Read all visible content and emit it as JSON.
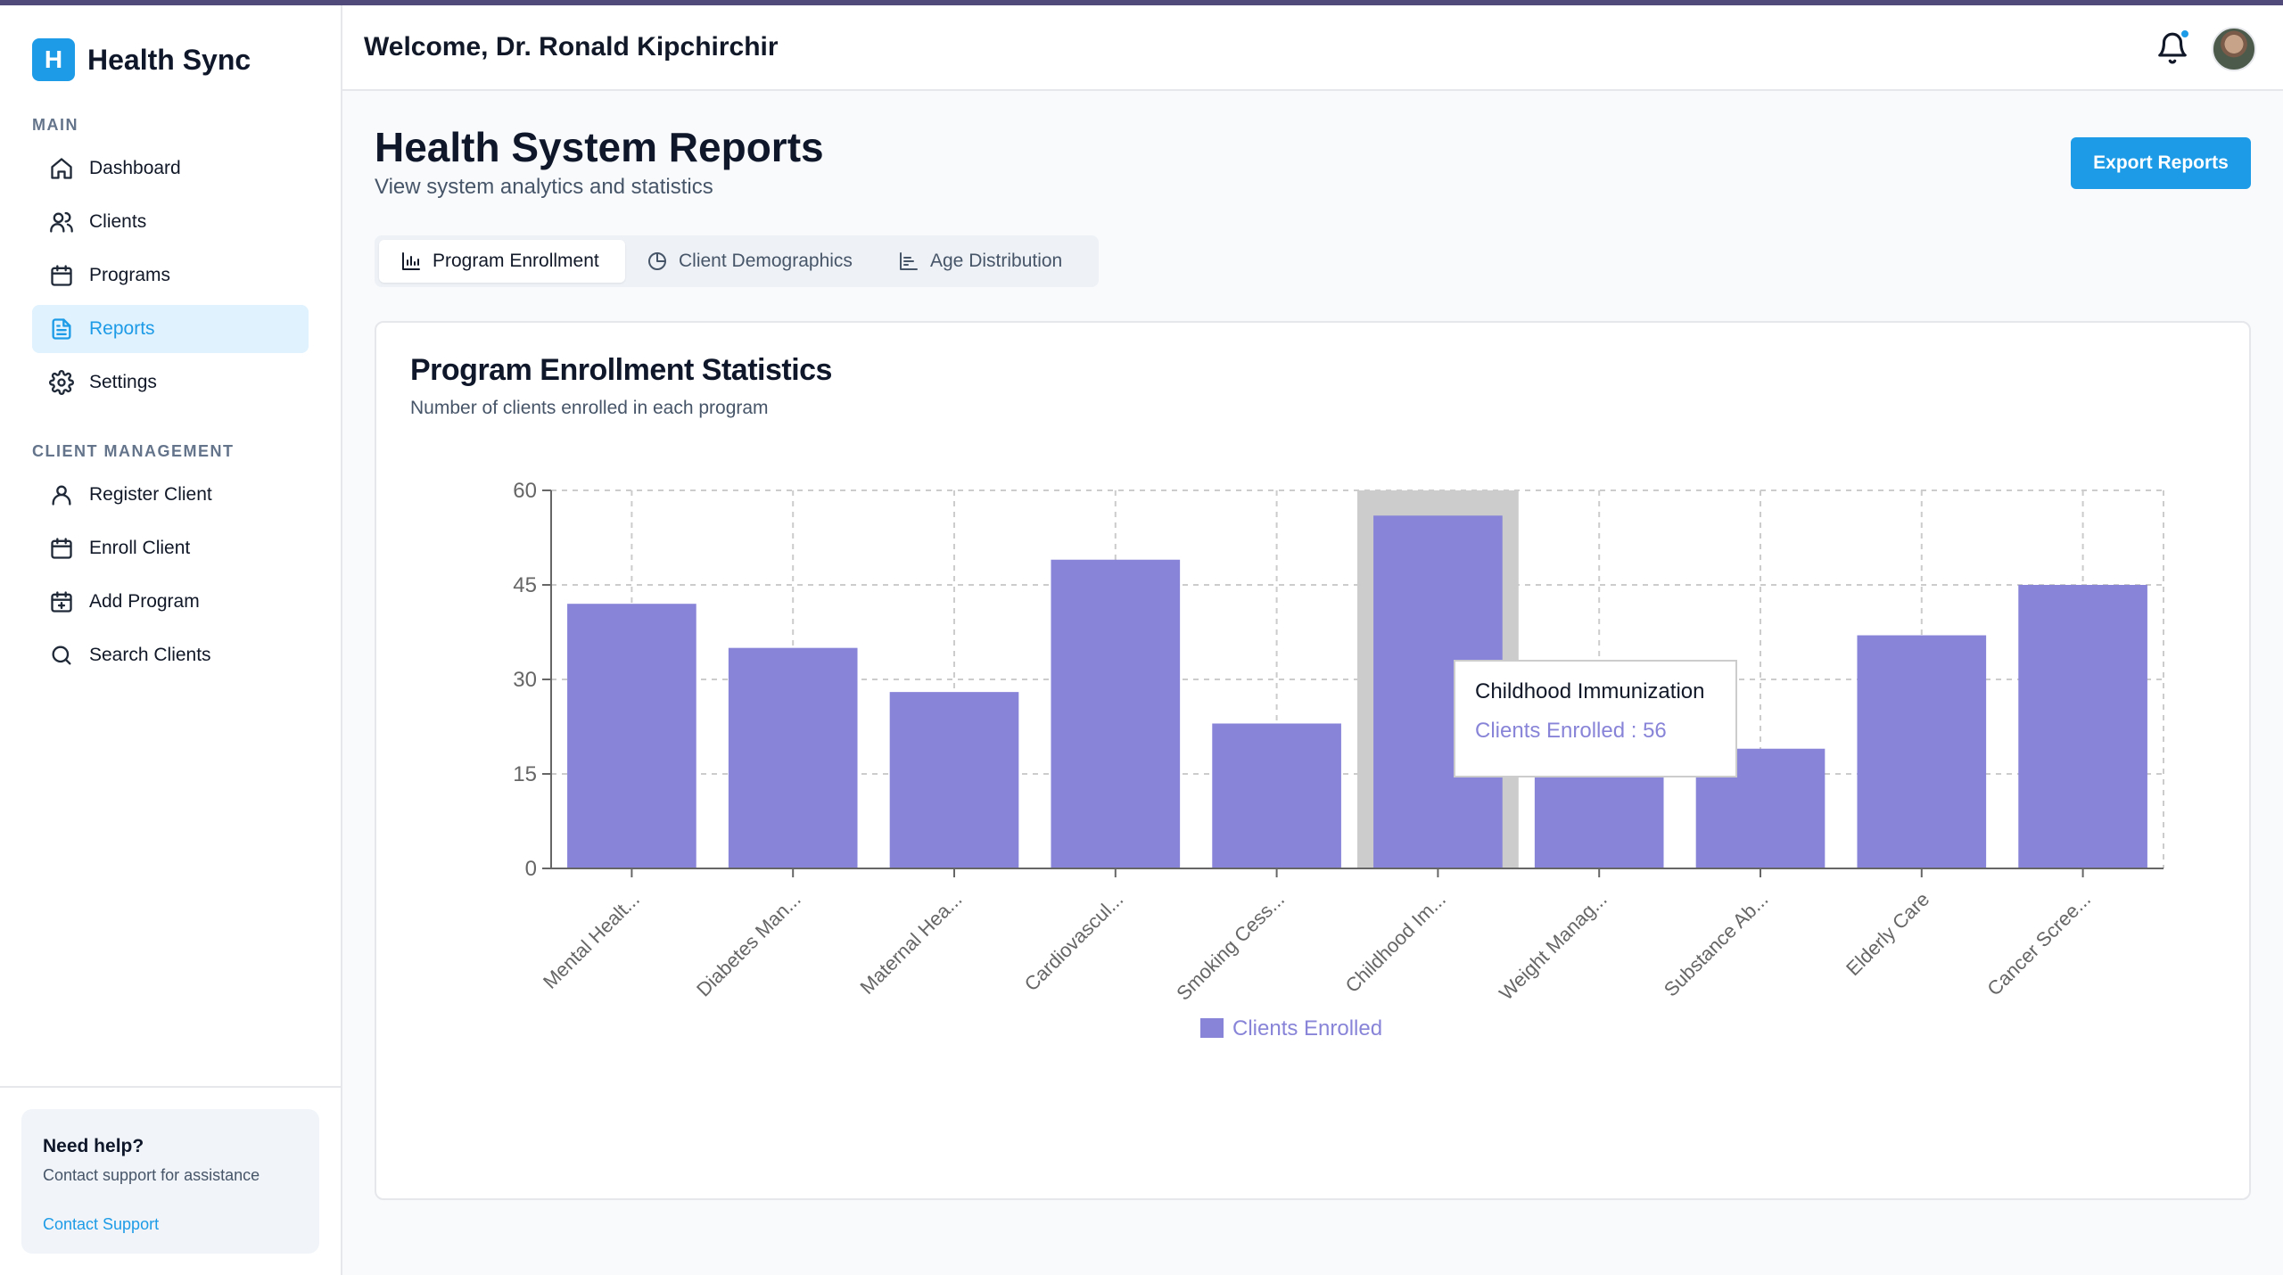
{
  "app": {
    "logo_letter": "H",
    "name": "Health Sync"
  },
  "sidebar": {
    "main_label": "MAIN",
    "main_items": [
      {
        "label": "Dashboard",
        "icon": "home-icon"
      },
      {
        "label": "Clients",
        "icon": "users-icon"
      },
      {
        "label": "Programs",
        "icon": "calendar-icon"
      },
      {
        "label": "Reports",
        "icon": "file-text-icon",
        "active": true
      },
      {
        "label": "Settings",
        "icon": "gear-icon"
      }
    ],
    "client_label": "CLIENT MANAGEMENT",
    "client_items": [
      {
        "label": "Register Client",
        "icon": "user-icon"
      },
      {
        "label": "Enroll Client",
        "icon": "calendar-icon"
      },
      {
        "label": "Add Program",
        "icon": "calendar-plus-icon"
      },
      {
        "label": "Search Clients",
        "icon": "search-icon"
      }
    ],
    "help": {
      "title": "Need help?",
      "text": "Contact support for assistance",
      "link": "Contact Support"
    }
  },
  "header": {
    "welcome": "Welcome, Dr. Ronald Kipchirchir"
  },
  "page": {
    "title": "Health System Reports",
    "subtitle": "View system analytics and statistics",
    "export_label": "Export Reports",
    "tabs": [
      {
        "label": "Program Enrollment",
        "icon": "bar-chart-icon",
        "active": true
      },
      {
        "label": "Client Demographics",
        "icon": "pie-chart-icon"
      },
      {
        "label": "Age Distribution",
        "icon": "bar-chart-icon"
      }
    ]
  },
  "card": {
    "title": "Program Enrollment Statistics",
    "subtitle": "Number of clients enrolled in each program"
  },
  "tooltip": {
    "title": "Childhood Immunization",
    "value": "Clients Enrolled : 56"
  },
  "colors": {
    "accent": "#1d9be6",
    "bar": "#8884d8",
    "hover_band": "#cccccc"
  },
  "chart_data": {
    "type": "bar",
    "categories": [
      "Mental Healt...",
      "Diabetes Man...",
      "Maternal Hea...",
      "Cardiovascul...",
      "Smoking Cess...",
      "Childhood Im...",
      "Weight Manag...",
      "Substance Ab...",
      "Elderly Care",
      "Cancer Scree..."
    ],
    "series": [
      {
        "name": "Clients Enrolled",
        "values": [
          42,
          35,
          28,
          49,
          23,
          56,
          24,
          19,
          37,
          45
        ]
      }
    ],
    "yticks": [
      0,
      15,
      30,
      45,
      60
    ],
    "ylim": [
      0,
      60
    ],
    "grid": true,
    "legend": "bottom",
    "highlight_index": 5
  }
}
